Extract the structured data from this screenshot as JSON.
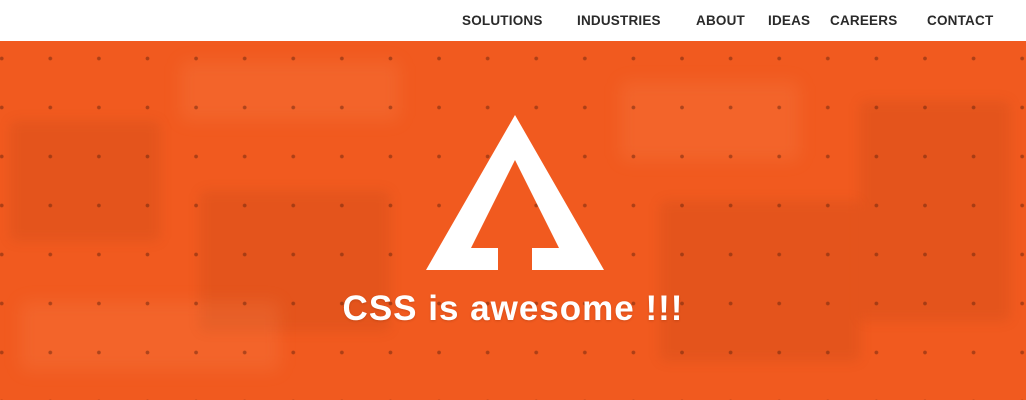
{
  "nav": {
    "items": [
      {
        "label": "SOLUTIONS"
      },
      {
        "label": "INDUSTRIES"
      },
      {
        "label": "ABOUT"
      },
      {
        "label": "IDEAS"
      },
      {
        "label": "CAREERS"
      },
      {
        "label": "CONTACT"
      }
    ]
  },
  "hero": {
    "logo_icon": "triangle-arrow-logo-icon",
    "tagline": "CSS is awesome !!!",
    "background_color": "#f15a1f"
  }
}
